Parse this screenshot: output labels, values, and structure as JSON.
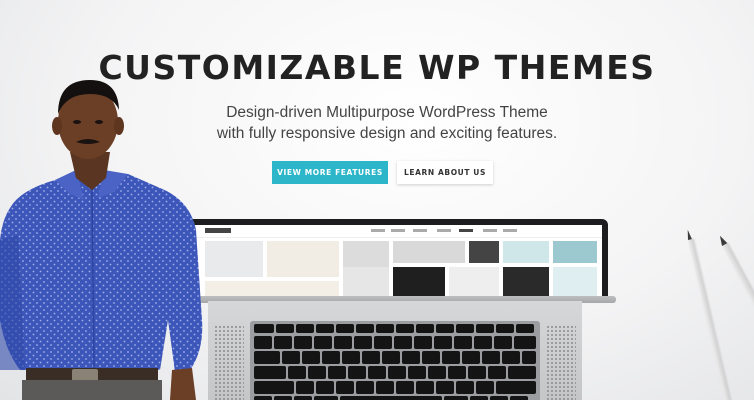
{
  "hero": {
    "title": "CUSTOMIZABLE WP THEMES",
    "subtitle_line1": "Design-driven Multipurpose WordPress Theme",
    "subtitle_line2": "with fully responsive design and exciting features.",
    "primary_button": "VIEW MORE FEATURES",
    "secondary_button": "LEARN ABOUT US"
  },
  "colors": {
    "accent": "#2db6c9",
    "title": "#222222",
    "shirt": "#3b55b8"
  },
  "icons": [
    "laptop-icon",
    "pencil-icon"
  ]
}
